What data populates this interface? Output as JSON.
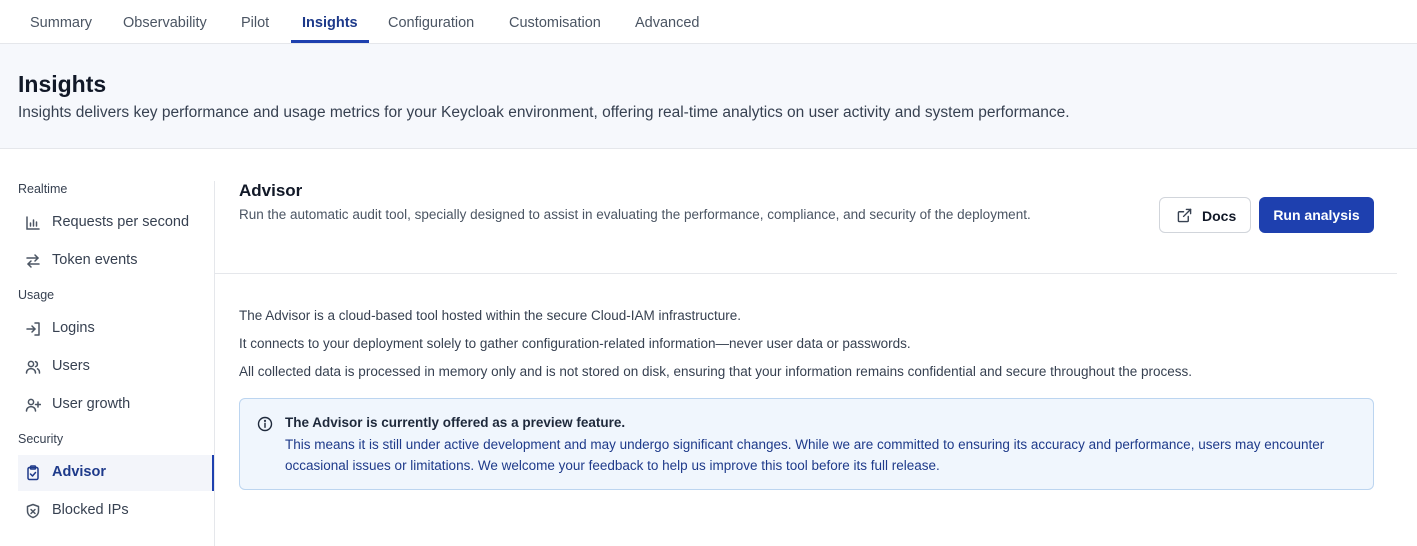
{
  "tabs": [
    {
      "label": "Summary"
    },
    {
      "label": "Observability"
    },
    {
      "label": "Pilot"
    },
    {
      "label": "Insights",
      "active": true
    },
    {
      "label": "Configuration"
    },
    {
      "label": "Customisation"
    },
    {
      "label": "Advanced"
    }
  ],
  "header": {
    "title": "Insights",
    "subtitle": "Insights delivers key performance and usage metrics for your Keycloak environment, offering real-time analytics on user activity and system performance."
  },
  "sidebar": {
    "groups": [
      {
        "label": "Realtime",
        "items": [
          {
            "label": "Requests per second",
            "icon": "bar-chart-icon"
          },
          {
            "label": "Token events",
            "icon": "arrows-swap-icon"
          }
        ]
      },
      {
        "label": "Usage",
        "items": [
          {
            "label": "Logins",
            "icon": "login-icon"
          },
          {
            "label": "Users",
            "icon": "users-icon"
          },
          {
            "label": "User growth",
            "icon": "user-plus-icon"
          }
        ]
      },
      {
        "label": "Security",
        "items": [
          {
            "label": "Advisor",
            "icon": "clipboard-check-icon",
            "active": true
          },
          {
            "label": "Blocked IPs",
            "icon": "shield-x-icon"
          }
        ]
      }
    ]
  },
  "advisor": {
    "title": "Advisor",
    "description": "Run the automatic audit tool, specially designed to assist in evaluating the performance, compliance, and security of the deployment.",
    "docs_label": "Docs",
    "run_label": "Run analysis",
    "paragraphs": [
      "The Advisor is a cloud-based tool hosted within the secure Cloud-IAM infrastructure.",
      "It connects to your deployment solely to gather configuration-related information—never user data or passwords.",
      "All collected data is processed in memory only and is not stored on disk, ensuring that your information remains confidential and secure throughout the process."
    ],
    "notice": {
      "title": "The Advisor is currently offered as a preview feature.",
      "body": "This means it is still under active development and may undergo significant changes. While we are committed to ensuring its accuracy and performance, users may encounter occasional issues or limitations. We welcome your feedback to help us improve this tool before its full release."
    }
  },
  "colors": {
    "accent": "#1e40af",
    "header_bg": "#f6f8fc",
    "notice_bg": "#f0f6fd",
    "notice_border": "#bcd5f0"
  }
}
